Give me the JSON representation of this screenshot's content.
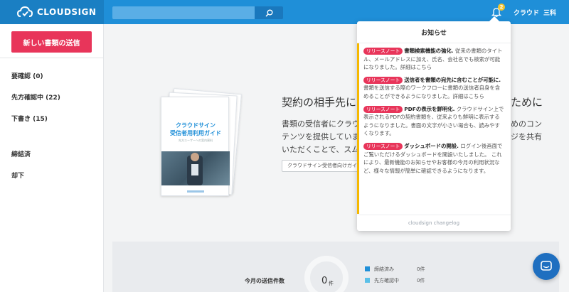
{
  "header": {
    "logo_text": "CLOUDSIGN",
    "search_placeholder": "",
    "notification_count": "2",
    "user_first": "クラウド",
    "user_last": "三科",
    "colors": {
      "header": "#1f8fd8",
      "logo_block": "#1a7fc3",
      "badge": "#f4c430"
    }
  },
  "sidebar": {
    "new_send_label": "新しい書類の送信",
    "items": [
      {
        "label": "要確認 (0)"
      },
      {
        "label": "先方確認中 (22)"
      },
      {
        "label": "下書き (15)"
      },
      {
        "label": "締結済"
      },
      {
        "label": "却下"
      }
    ],
    "colors": {
      "new_send": "#e8355a"
    }
  },
  "main": {
    "guide": {
      "title_line1": "クラウドサイン",
      "title_line2": "受信者用利用ガイド",
      "subtitle": "先方ユーザーへの案内資料"
    },
    "heading": "契約の相手先に",
    "heading_tail": "ために",
    "body_lines": [
      {
        "text": "書類の受信者にクラウ",
        "tail": "めのコン"
      },
      {
        "text": "テンツを提供していま",
        "tail": "ジを共有"
      },
      {
        "text": "いただくことで、スムー",
        "tail": ""
      }
    ],
    "guide_button": "クラウドサイン受信者向けガイド"
  },
  "stats": {
    "title": "今月の送信件数",
    "count": "0",
    "count_unit": "件",
    "legend": [
      {
        "label": "締結済み",
        "count": "0件",
        "color": "#1f8fd8"
      },
      {
        "label": "先方確認中",
        "count": "0件",
        "color": "#5bc0e8"
      }
    ]
  },
  "notifications": {
    "title": "お知らせ",
    "tag_label": "リリースノート",
    "items": [
      {
        "headline": "書類検索機能の強化.",
        "body": " 従来の書類のタイトル、メールアドレスに加え、氏名、会社名でも検索が可能になりました。詳細はこちら"
      },
      {
        "headline": "送信者を書類の宛先に含むことが可能に.",
        "body": " 書類を送信する際のワークフローに書類の送信者自身を含めることができるようになりました。詳細はこちら"
      },
      {
        "headline": "PDFの表示を鮮明化.",
        "body": " クラウドサイン上で表示されるPDFの契約書類を、従来よりも鮮明に表示するようになりました。書面の文字が小さい場合も、読みやすくなります。"
      },
      {
        "headline": "ダッシュボードの開設.",
        "body": " ログイン後画面でご覧いただけるダッシュボードを開設いたしました。 これにより、最新機能のお知らせやお客様の今月の利用状況など、様々な情報が簡単に確認できるようになります。"
      }
    ],
    "footer_link": "cloudsign changelog",
    "colors": {
      "tag": "#e8355a",
      "accent": "#f5b800"
    }
  }
}
